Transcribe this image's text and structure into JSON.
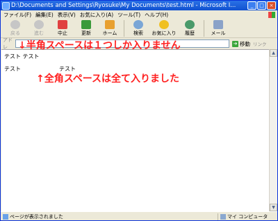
{
  "window": {
    "title": "D:\\Documents and Settings\\Ryosuke\\My Documents\\test.html - Microsoft I..."
  },
  "menu": [
    "ファイル(F)",
    "編集(E)",
    "表示(V)",
    "お気に入り(A)",
    "ツール(T)",
    "ヘルプ(H)"
  ],
  "toolbar": {
    "back": "戻る",
    "forward": "進む",
    "stop": "中止",
    "refresh": "更新",
    "home": "ホーム",
    "search": "検索",
    "favorites": "お気に入り",
    "history": "履歴",
    "mail": "メール"
  },
  "address": {
    "label": "アドレ",
    "go": "移動",
    "links": "リンク"
  },
  "page": {
    "line1": "テスト テスト",
    "line2_left": "テスト",
    "line2_right": "テスト"
  },
  "annotations": {
    "half_width": "↓半角スペースは１つしか入りません",
    "full_width": "↑全角スペースは全て入りました"
  },
  "status": {
    "text": "ページが表示されました",
    "zone": "マイ コンピュータ"
  },
  "colors": {
    "annotation": "#ff2020",
    "titlebar": "#1f5fd8"
  }
}
